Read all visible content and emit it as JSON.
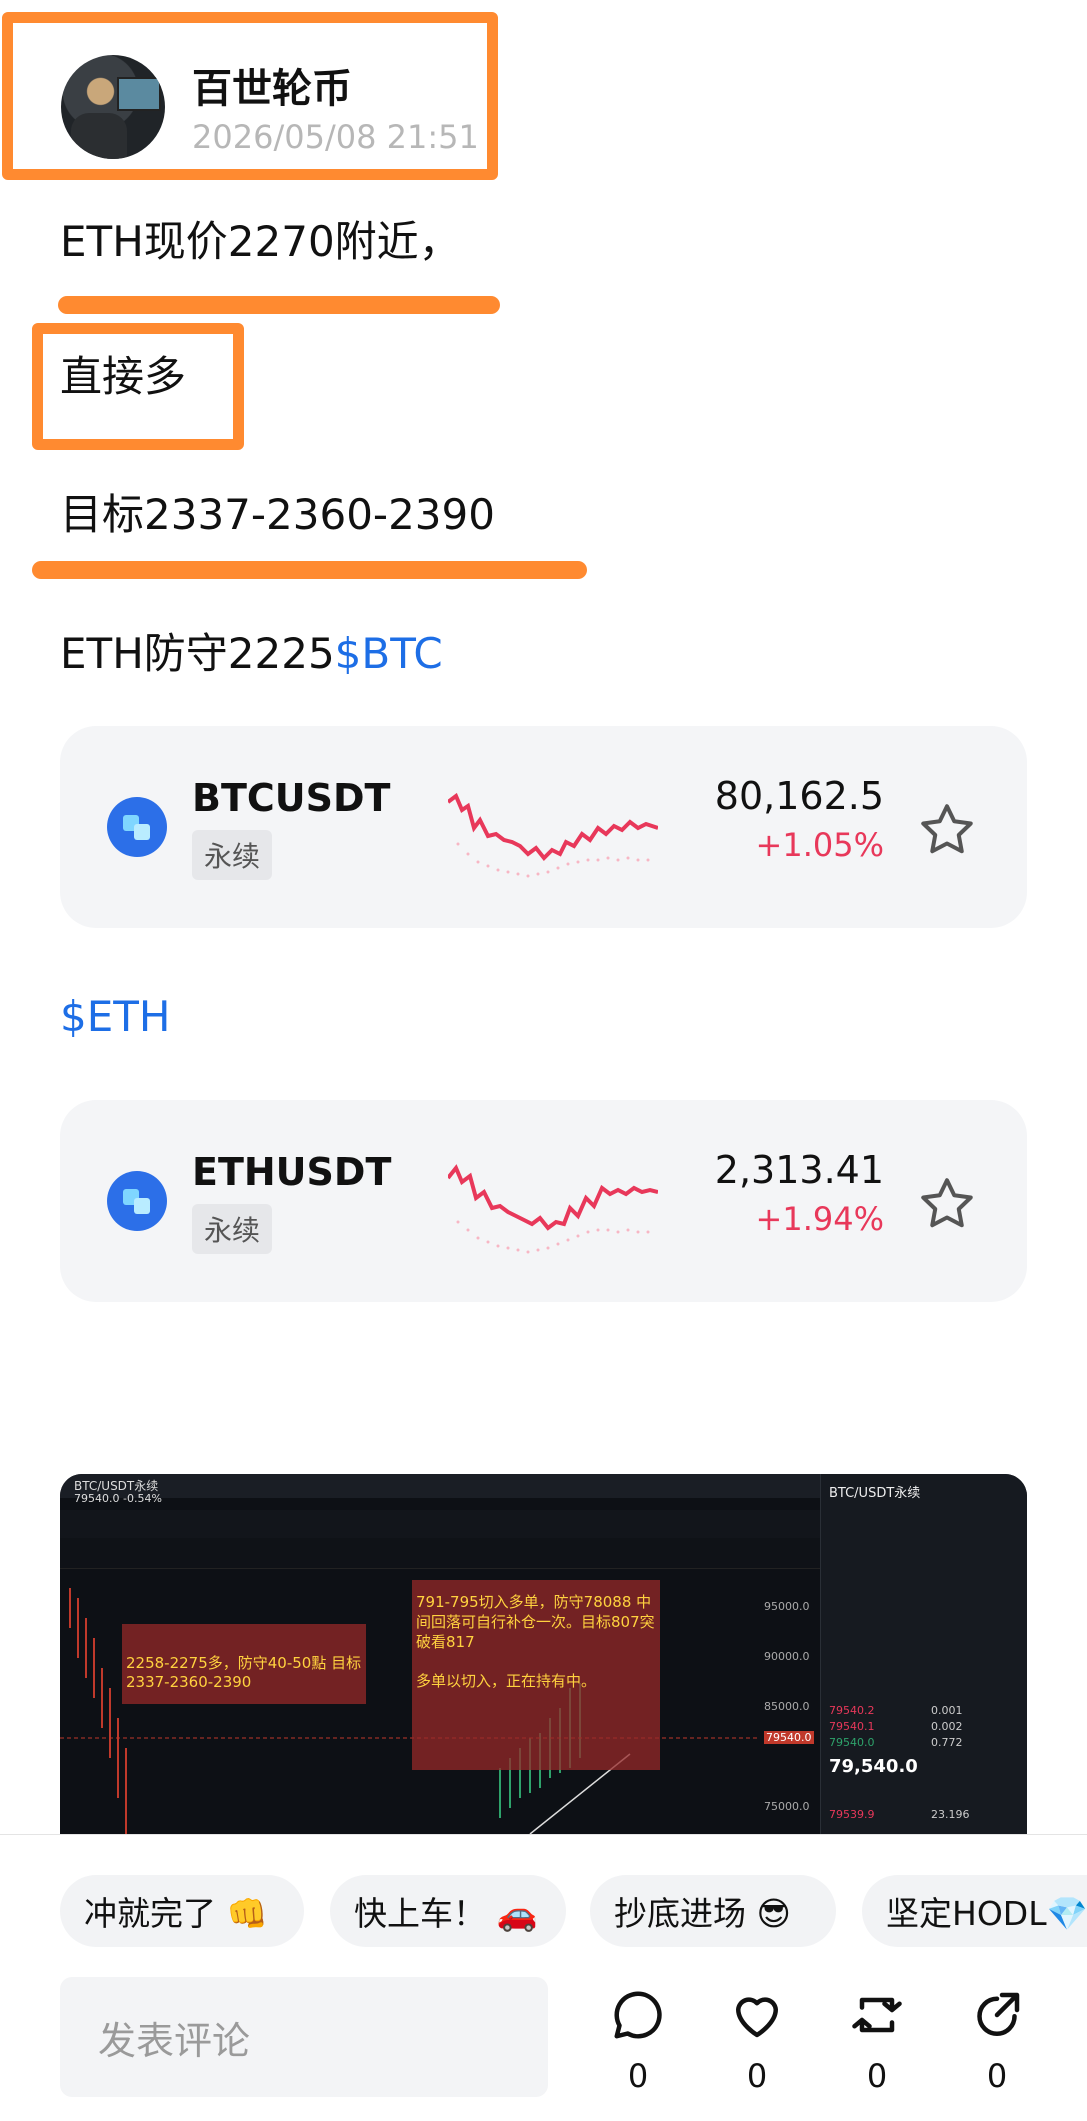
{
  "author": {
    "name": "百世轮币",
    "timestamp": "2026/05/08 21:51"
  },
  "post": {
    "line1": "ETH现价2270附近，",
    "line2": "直接多",
    "line3": "目标2337-2360-2390",
    "line4_text": "ETH防守2225",
    "line4_tag": "$BTC",
    "tag2": "$ETH"
  },
  "cards": [
    {
      "symbol": "BTCUSDT",
      "badge": "永续",
      "price": "80,162.5",
      "change": "+1.05%"
    },
    {
      "symbol": "ETHUSDT",
      "badge": "永续",
      "price": "2,313.41",
      "change": "+1.94%"
    }
  ],
  "chart_shot": {
    "title": "BTC/USDT永续",
    "price_line": "79540.0 -0.54%",
    "right_title": "BTC/USDT永续",
    "note_left": "2258-2275多，防守40-50點 目标2337-2360-2390",
    "note_right_1": "791-795切入多单，防守78088  中间回落可自行补仓一次。目标807突破看817",
    "note_right_2": "多单以切入，正在持有中。",
    "axis": [
      "95000.0",
      "90000.0",
      "85000.0",
      "79540.0",
      "75000.0"
    ],
    "orderbook": [
      {
        "price": "79540.2",
        "qty": "0.001"
      },
      {
        "price": "79540.1",
        "qty": "0.002"
      },
      {
        "price": "79540.0",
        "qty": "0.772"
      }
    ],
    "last": "79,540.0",
    "bottom_row": {
      "price": "79539.9",
      "qty": "23.196"
    }
  },
  "reactions": [
    {
      "label": "冲就完了 👊"
    },
    {
      "label": "快上车！ 🚗"
    },
    {
      "label": "抄底进场 😎"
    },
    {
      "label": "坚定HODL💎"
    }
  ],
  "comment_placeholder": "发表评论",
  "actions": [
    {
      "icon": "comment-icon",
      "count": "0"
    },
    {
      "icon": "heart-icon",
      "count": "0"
    },
    {
      "icon": "repost-icon",
      "count": "0"
    },
    {
      "icon": "share-icon",
      "count": "0"
    }
  ],
  "colors": {
    "accent": "#ff8a30",
    "link": "#1d6ee6",
    "up": "#e8385a"
  }
}
